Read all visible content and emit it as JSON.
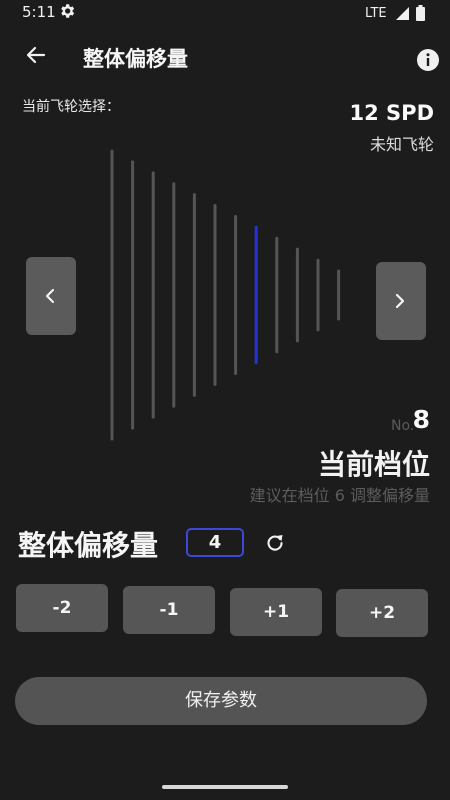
{
  "status": {
    "time": "5:11",
    "network": "LTE"
  },
  "header": {
    "title": "整体偏移量"
  },
  "flywheel": {
    "label": "当前飞轮选择：",
    "speed": "12 SPD",
    "name": "未知飞轮"
  },
  "cassette": {
    "cog_count": 12,
    "selected": 8,
    "colors": {
      "cog": "#555555",
      "selected": "#2432d4"
    }
  },
  "gear": {
    "no_label": "No.",
    "number": "8",
    "title": "当前档位",
    "hint": "建议在档位 6 调整偏移量"
  },
  "offset": {
    "title": "整体偏移量",
    "value": "4"
  },
  "buttons": {
    "minus2": "-2",
    "minus1": "-1",
    "plus1": "+1",
    "plus2": "+2",
    "save": "保存参数"
  }
}
